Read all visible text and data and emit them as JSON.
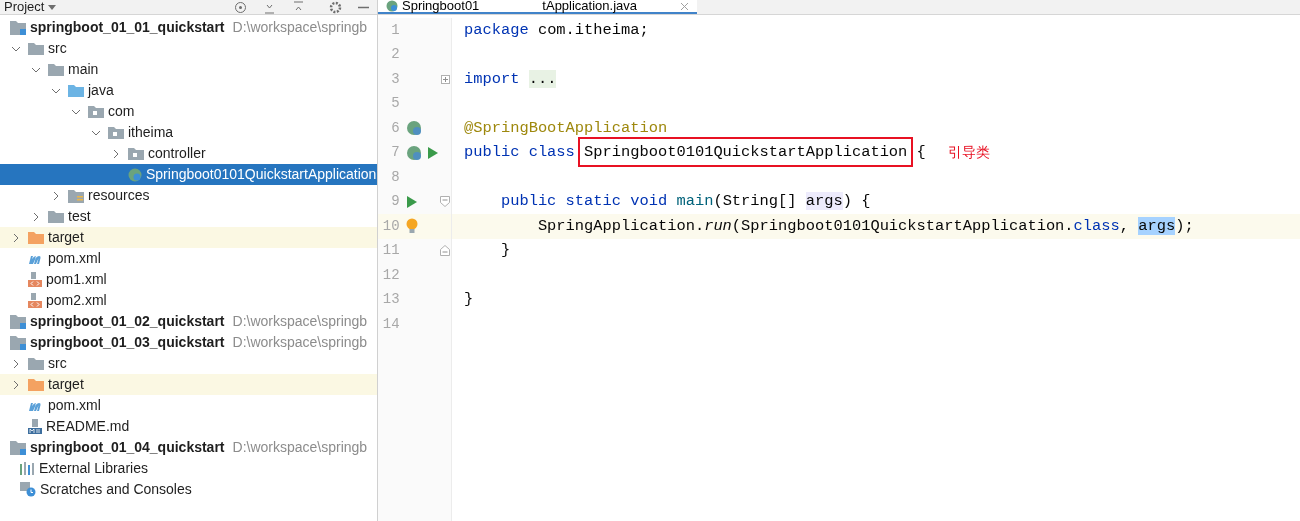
{
  "project_panel": {
    "title": "Project",
    "tree": [
      {
        "label": "springboot_01_01_quickstart",
        "hint": "D:\\workspace\\springb",
        "kind": "module",
        "selected": false,
        "children": [
          {
            "label": "src",
            "kind": "folder",
            "expanded": true,
            "selected": false,
            "children": [
              {
                "label": "main",
                "kind": "folder",
                "expanded": true,
                "selected": false,
                "children": [
                  {
                    "label": "java",
                    "kind": "source-folder",
                    "expanded": true,
                    "selected": false,
                    "children": [
                      {
                        "label": "com",
                        "kind": "package",
                        "expanded": true,
                        "selected": false,
                        "children": [
                          {
                            "label": "itheima",
                            "kind": "package",
                            "expanded": true,
                            "selected": false,
                            "children": [
                              {
                                "label": "controller",
                                "kind": "package",
                                "expanded": false,
                                "selected": false
                              },
                              {
                                "label": "Springboot0101QuickstartApplication",
                                "kind": "spring-class",
                                "selected": true
                              }
                            ]
                          }
                        ]
                      }
                    ]
                  },
                  {
                    "label": "resources",
                    "kind": "resources",
                    "expanded": false,
                    "selected": false
                  }
                ]
              },
              {
                "label": "test",
                "kind": "folder",
                "expanded": false,
                "selected": false
              }
            ]
          },
          {
            "label": "target",
            "kind": "excluded",
            "expanded": false,
            "selected": false
          },
          {
            "label": "pom.xml",
            "kind": "maven",
            "selected": false
          },
          {
            "label": "pom1.xml",
            "kind": "xml",
            "selected": false
          },
          {
            "label": "pom2.xml",
            "kind": "xml",
            "selected": false
          }
        ]
      },
      {
        "label": "springboot_01_02_quickstart",
        "hint": "D:\\workspace\\springb",
        "kind": "module",
        "selected": false
      },
      {
        "label": "springboot_01_03_quickstart",
        "hint": "D:\\workspace\\springb",
        "kind": "module",
        "selected": false,
        "children": [
          {
            "label": "src",
            "kind": "folder",
            "expanded": false,
            "selected": false
          },
          {
            "label": "target",
            "kind": "excluded",
            "expanded": false,
            "selected": false
          },
          {
            "label": "pom.xml",
            "kind": "maven",
            "selected": false
          },
          {
            "label": "README.md",
            "kind": "markdown",
            "selected": false
          }
        ]
      },
      {
        "label": "springboot_01_04_quickstart",
        "hint": "D:\\workspace\\springb",
        "kind": "module",
        "selected": false
      },
      {
        "label": "External Libraries",
        "kind": "libraries",
        "selected": false
      },
      {
        "label": "Scratches and Consoles",
        "kind": "scratches",
        "selected": false
      }
    ]
  },
  "editor": {
    "tab": {
      "label_start": "Springboot01",
      "label_end": "tApplication.java",
      "selected": true
    },
    "lines": [
      {
        "number": "1",
        "tokens": [
          {
            "text": "package",
            "kind": "keyword"
          },
          {
            "text": " com.itheima;",
            "kind": "plain"
          }
        ]
      },
      {
        "number": "2"
      },
      {
        "number": "3",
        "fold": {
          "kind": "collapsed"
        },
        "tokens": [
          {
            "text": "import",
            "kind": "keyword"
          },
          {
            "text": "...",
            "kind": "folded"
          }
        ]
      },
      {
        "number": "5"
      },
      {
        "number": "6",
        "gutter": [
          {
            "kind": "bean"
          }
        ],
        "tokens": [
          {
            "text": "@SpringBootApplication",
            "kind": "annotation"
          }
        ]
      },
      {
        "number": "7",
        "gutter": [
          {
            "kind": "bean"
          },
          {
            "kind": "run"
          }
        ],
        "tokens": [
          {
            "text": "public class ",
            "kind": "keyword"
          },
          {
            "text": "Springboot0101QuickstartApplication",
            "kind": "boxed"
          },
          {
            "text": " {",
            "kind": "plain"
          }
        ],
        "callout": "引导类"
      },
      {
        "number": "8"
      },
      {
        "number": "9",
        "gutter": [
          {
            "kind": "run"
          }
        ],
        "fold": {
          "kind": "open"
        },
        "tokens": [
          {
            "text": "    public static void ",
            "kind": "keyword"
          },
          {
            "text": "main",
            "kind": "method"
          },
          {
            "text": "(String[] ",
            "kind": "plain"
          },
          {
            "text": "args",
            "kind": "usage"
          },
          {
            "text": ") {",
            "kind": "plain"
          }
        ]
      },
      {
        "number": "10",
        "gutter": [
          {
            "kind": "bulb"
          }
        ],
        "current": true,
        "tokens": [
          {
            "text": "        SpringApplication.",
            "kind": "plain"
          },
          {
            "text": "run",
            "kind": "static-call"
          },
          {
            "text": "(Springboot0101QuickstartApplication.",
            "kind": "plain"
          },
          {
            "text": "class",
            "kind": "keyword"
          },
          {
            "text": ", ",
            "kind": "plain"
          },
          {
            "text": "args",
            "kind": "selection"
          },
          {
            "text": ");",
            "kind": "plain"
          }
        ]
      },
      {
        "number": "11",
        "fold": {
          "kind": "close"
        },
        "tokens": [
          {
            "text": "    }",
            "kind": "plain"
          }
        ]
      },
      {
        "number": "12"
      },
      {
        "number": "13",
        "tokens": [
          {
            "text": "}",
            "kind": "plain"
          }
        ]
      },
      {
        "number": "14"
      }
    ]
  }
}
